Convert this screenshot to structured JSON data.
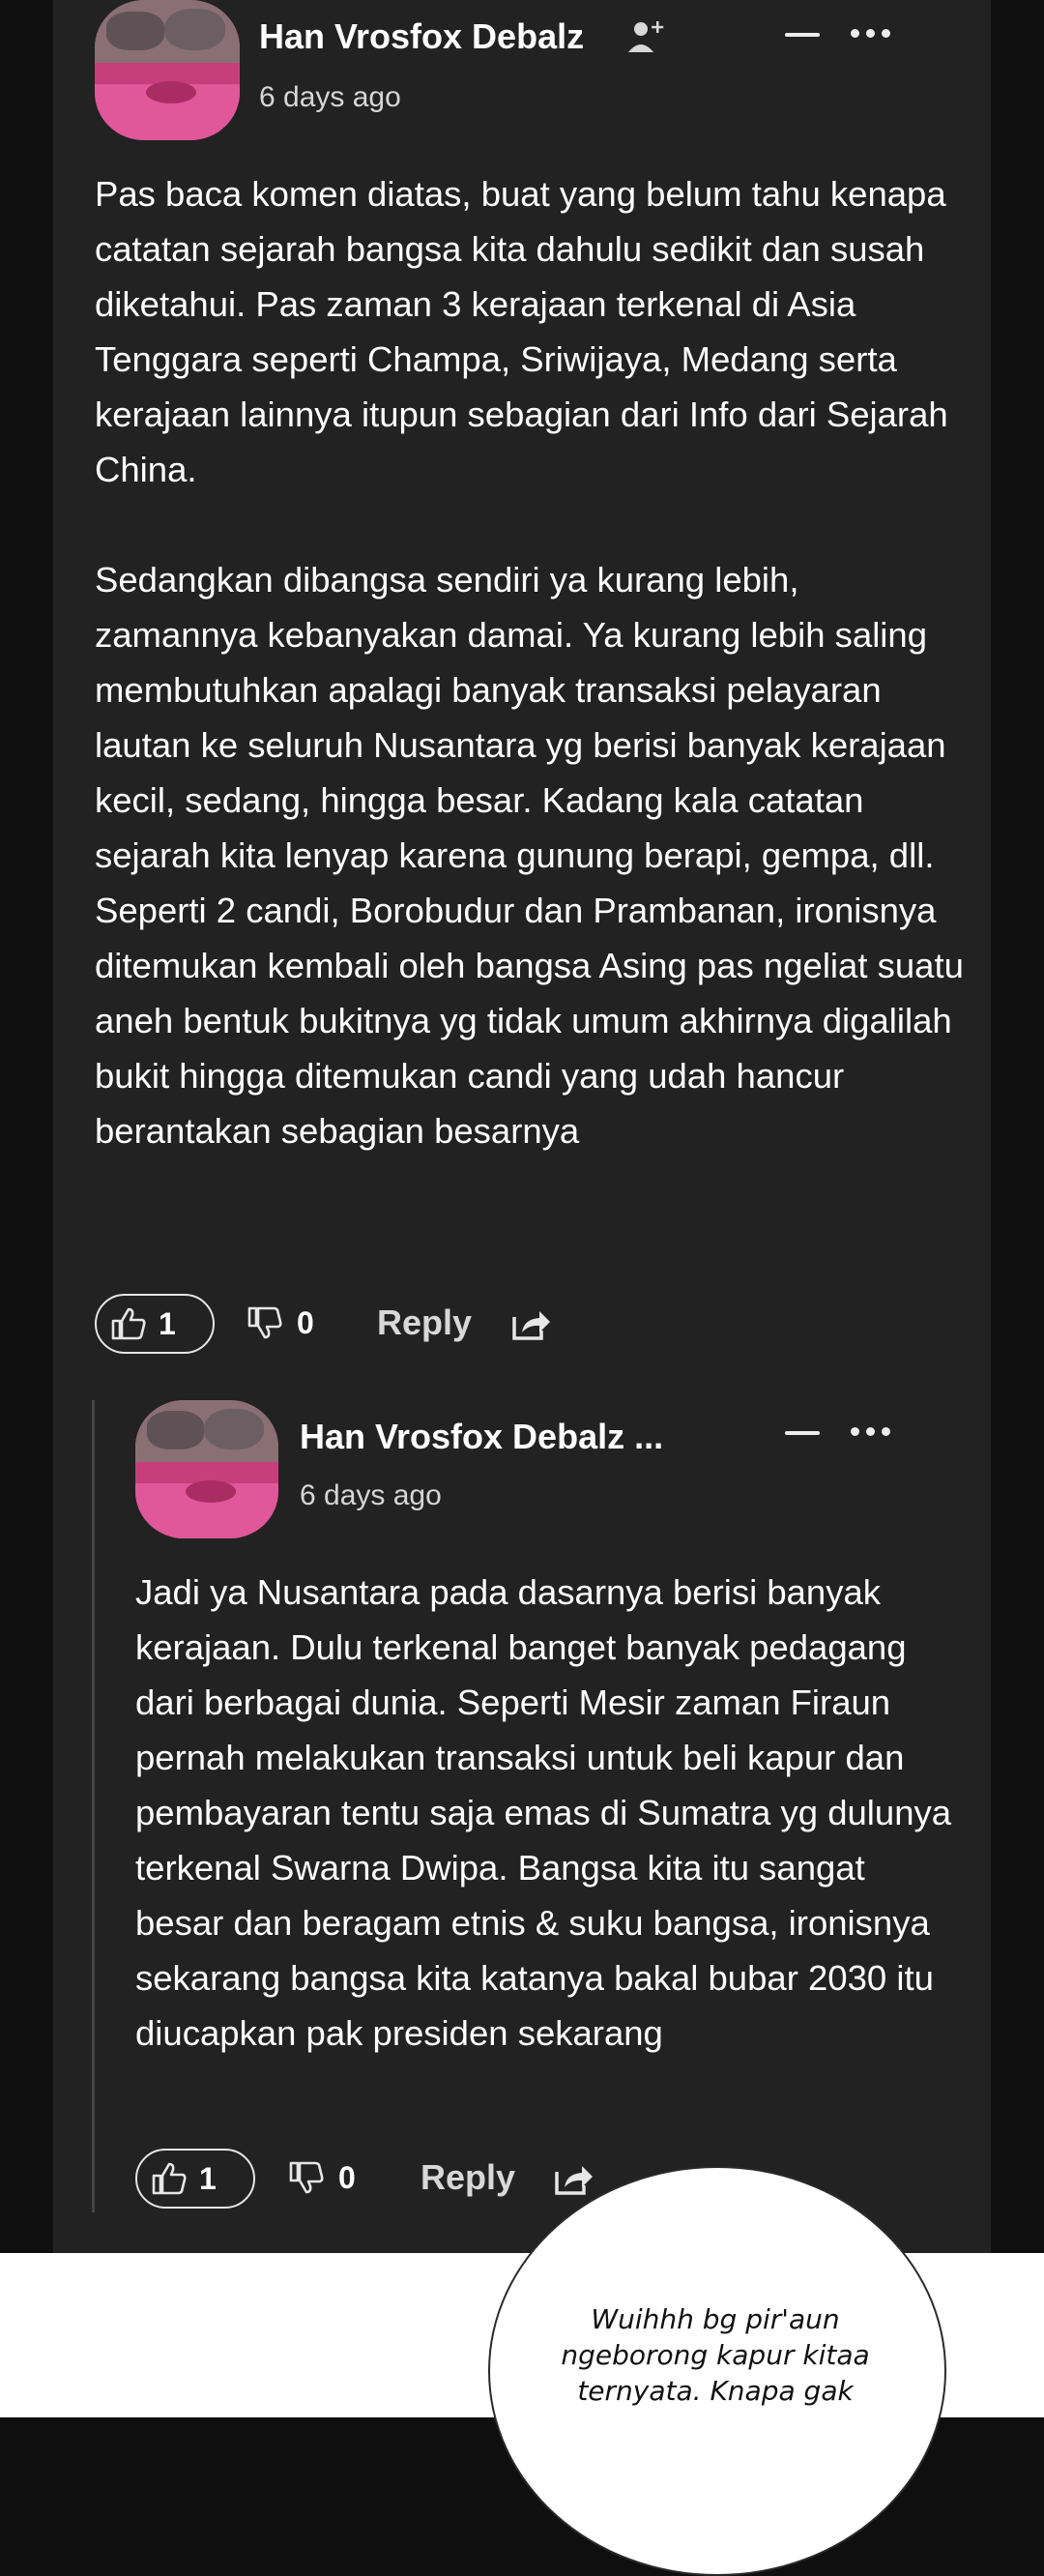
{
  "comment": {
    "author": "Han Vrosfox Debalz",
    "time": "6 days ago",
    "paragraphs": [
      "Pas baca komen diatas, buat yang belum tahu kenapa catatan sejarah bangsa kita dahulu sedikit dan susah diketahui. Pas zaman 3 kerajaan terkenal di Asia Tenggara seperti Champa, Sriwijaya, Medang serta kerajaan lainnya itupun sebagian dari Info dari Sejarah China.",
      "Sedangkan dibangsa sendiri ya kurang lebih, zamannya kebanyakan damai. Ya kurang lebih saling membutuhkan apalagi banyak transaksi pelayaran lautan ke seluruh Nusantara yg berisi banyak kerajaan kecil, sedang, hingga besar. Kadang kala catatan sejarah kita lenyap karena gunung berapi, gempa, dll. Seperti 2 candi, Borobudur dan Prambanan, ironisnya ditemukan kembali oleh bangsa Asing pas ngeliat suatu aneh bentuk bukitnya yg tidak umum akhirnya digalilah bukit hingga ditemukan candi yang udah hancur berantakan sebagian besarnya"
    ],
    "likes": "1",
    "dislikes": "0",
    "reply_label": "Reply"
  },
  "reply_comment": {
    "author": "Han Vrosfox Debalz ...",
    "time": "6 days ago",
    "paragraphs": [
      "Jadi ya Nusantara pada dasarnya berisi banyak kerajaan. Dulu terkenal banget banyak pedagang dari berbagai dunia. Seperti Mesir zaman Firaun pernah melakukan transaksi untuk beli kapur dan pembayaran tentu saja emas di Sumatra yg dulunya terkenal Swarna Dwipa. Bangsa kita itu sangat besar dan beragam etnis & suku bangsa, ironisnya sekarang bangsa kita katanya bakal bubar 2030 itu diucapkan pak presiden sekarang"
    ],
    "likes": "1",
    "dislikes": "0",
    "reply_label": "Reply"
  },
  "speech_bubble": {
    "lines": [
      "Wuihhh bg pir'aun",
      "ngeborong kapur kitaa",
      "ternyata. Knapa gak"
    ]
  },
  "icons": {
    "add_friend": "add-friend-icon",
    "collapse": "minus-icon",
    "more": "more-options-icon",
    "like": "thumbs-up-icon",
    "dislike": "thumbs-down-icon",
    "share": "share-icon"
  }
}
